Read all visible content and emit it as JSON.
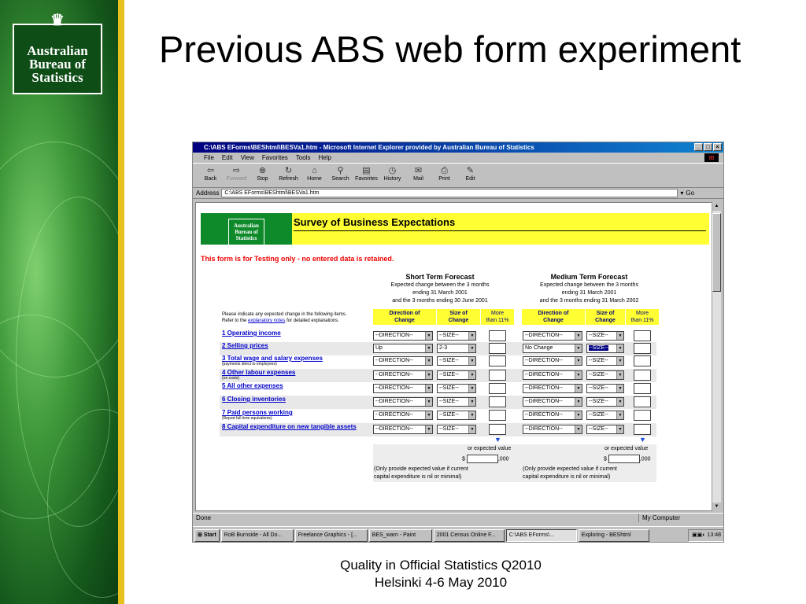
{
  "slide": {
    "title": "Previous ABS web form experiment",
    "footer_line1": "Quality in Official Statistics Q2010",
    "footer_line2": "Helsinki 4-6 May 2010",
    "logo_lines": [
      "Australian",
      "Bureau of",
      "Statistics"
    ]
  },
  "browser": {
    "title": "C:\\ABS EForms\\BEShtml\\BESVa1.htm - Microsoft Internet Explorer provided by Australian Bureau of Statistics",
    "menu": [
      "File",
      "Edit",
      "View",
      "Favorites",
      "Tools",
      "Help"
    ],
    "toolbar": [
      "Back",
      "Forward",
      "Stop",
      "Refresh",
      "Home",
      "Search",
      "Favorites",
      "History",
      "Mail",
      "Print",
      "Edit"
    ],
    "address_label": "Address",
    "address": "C:\\ABS EForms\\BEShtml\\BESVa1.htm",
    "go": "Go",
    "status": "Done",
    "zone": "My Computer"
  },
  "taskbar": {
    "start": "Start",
    "tasks": [
      "RoB Burnside - All Do...",
      "Freelance Graphics - [...",
      "BES_warn - Paint",
      "2001 Census Online F...",
      "C:\\ABS EForms\\...",
      "Exploring - BEShtml"
    ],
    "active_index": 4,
    "clock": "13:48"
  },
  "form": {
    "survey_title": "Survey of Business Expectations",
    "logo_lines": [
      "Australian",
      "Bureau of",
      "Statistics"
    ],
    "test_note": "This form is for Testing only - no entered data is retained.",
    "short_term": {
      "heading": "Short Term Forecast",
      "line1": "Expected change between the 3 months",
      "line2": "ending 31 March 2001",
      "line3": "and the 3 months ending 30 June 2001"
    },
    "medium_term": {
      "heading": "Medium Term Forecast",
      "line1": "Expected change between the 3 months",
      "line2": "ending 31 March 2001",
      "line3": "and the 3 months ending 31 March 2002"
    },
    "col_direction": [
      "Direction of",
      "Change"
    ],
    "col_size": [
      "Size of",
      "Change"
    ],
    "col_more": [
      "More",
      "than 11%"
    ],
    "instruction_1": "Please indicate any expected change in the following items.",
    "instruction_2a": "Refer to the",
    "instruction_link": "explanatory notes",
    "instruction_2b": "for detailed explanations.",
    "rows": [
      {
        "label": "1 Operating income",
        "sub": "",
        "st_dir": "--DIRECTION--",
        "st_size": "--SIZE--",
        "mt_dir": "--DIRECTION--",
        "mt_size": "--SIZE--"
      },
      {
        "label": "2 Selling prices",
        "sub": "",
        "st_dir": "Up",
        "st_size": "2-3",
        "mt_dir": "No Change",
        "mt_size": "--SIZE--"
      },
      {
        "label": "3 Total wage and salary expenses",
        "sub": "(payments direct to employees)",
        "st_dir": "--DIRECTION--",
        "st_size": "--SIZE--",
        "mt_dir": "--DIRECTION--",
        "mt_size": "--SIZE--"
      },
      {
        "label": "4 Other labour expenses",
        "sub": "(on costs)",
        "st_dir": "--DIRECTION--",
        "st_size": "--SIZE--",
        "mt_dir": "--DIRECTION--",
        "mt_size": "--SIZE--"
      },
      {
        "label": "5 All other expenses",
        "sub": "",
        "st_dir": "--DIRECTION--",
        "st_size": "--SIZE--",
        "mt_dir": "--DIRECTION--",
        "mt_size": "--SIZE--"
      },
      {
        "label": "6 Closing inventories",
        "sub": "",
        "st_dir": "--DIRECTION--",
        "st_size": "--SIZE--",
        "mt_dir": "--DIRECTION--",
        "mt_size": "--SIZE--"
      },
      {
        "label": "7 Paid persons working",
        "sub": "(Report full time equivalents)",
        "st_dir": "--DIRECTION--",
        "st_size": "--SIZE--",
        "mt_dir": "--DIRECTION--",
        "mt_size": "--SIZE--"
      },
      {
        "label": "8 Capital expenditure on new tangible assets",
        "sub": "",
        "st_dir": "--DIRECTION--",
        "st_size": "--SIZE--",
        "mt_dir": "--DIRECTION--",
        "mt_size": "--SIZE--"
      }
    ],
    "expected_value_label": "or expected value",
    "dollar": "$",
    "thousands": ",000",
    "expected_note_1": "(Only provide expected value if current",
    "expected_note_2": "capital expenditure is nil or minimal)"
  },
  "colors": {
    "header_yellow": "#ffff33",
    "link_blue": "#0000cc",
    "warning_red": "#ee0000",
    "abs_green": "#0f8a2a",
    "slide_gold": "#e7c21f"
  }
}
